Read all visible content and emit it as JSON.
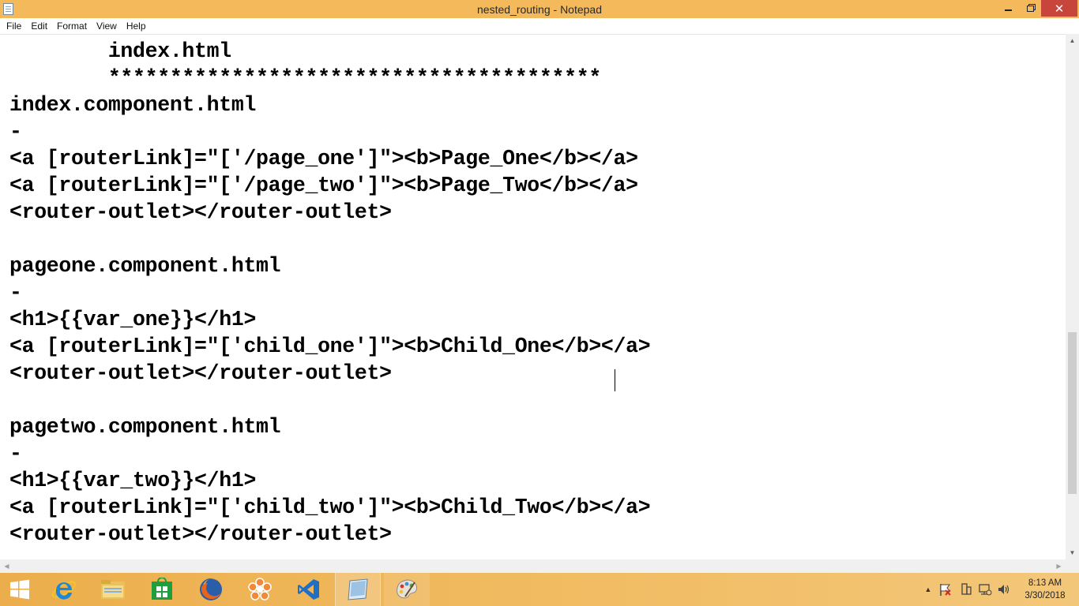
{
  "window": {
    "title": "nested_routing - Notepad",
    "min_label": "",
    "close_label": "✕"
  },
  "menu": {
    "items": [
      {
        "label": "File"
      },
      {
        "label": "Edit"
      },
      {
        "label": "Format"
      },
      {
        "label": "View"
      },
      {
        "label": "Help"
      }
    ]
  },
  "editor": {
    "content": "        index.html\n        ****************************************\nindex.component.html\n-\n<a [routerLink]=\"['/page_one']\"><b>Page_One</b></a>\n<a [routerLink]=\"['/page_two']\"><b>Page_Two</b></a>\n<router-outlet></router-outlet>\n\npageone.component.html\n-\n<h1>{{var_one}}</h1>\n<a [routerLink]=\"['child_one']\"><b>Child_One</b></a>\n<router-outlet></router-outlet>\n\npagetwo.component.html\n-\n<h1>{{var_two}}</h1>\n<a [routerLink]=\"['child_two']\"><b>Child_Two</b></a>\n<router-outlet></router-outlet>"
  },
  "taskbar": {
    "apps": [
      {
        "name": "start",
        "icon": "windows-logo-icon"
      },
      {
        "name": "internet-explorer",
        "icon": "internet-explorer-icon"
      },
      {
        "name": "file-explorer",
        "icon": "folder-icon"
      },
      {
        "name": "store",
        "icon": "store-icon"
      },
      {
        "name": "firefox",
        "icon": "firefox-icon"
      },
      {
        "name": "flower-app",
        "icon": "flower-icon"
      },
      {
        "name": "vs-code",
        "icon": "vscode-icon"
      },
      {
        "name": "notepad",
        "icon": "notepad-icon"
      },
      {
        "name": "paint",
        "icon": "paint-palette-icon"
      }
    ]
  },
  "clock": {
    "time": "8:13 AM",
    "date": "3/30/2018"
  },
  "colors": {
    "titlebar": "#f3b95b",
    "close": "#c7453a",
    "taskbar": "#ecae4c"
  }
}
